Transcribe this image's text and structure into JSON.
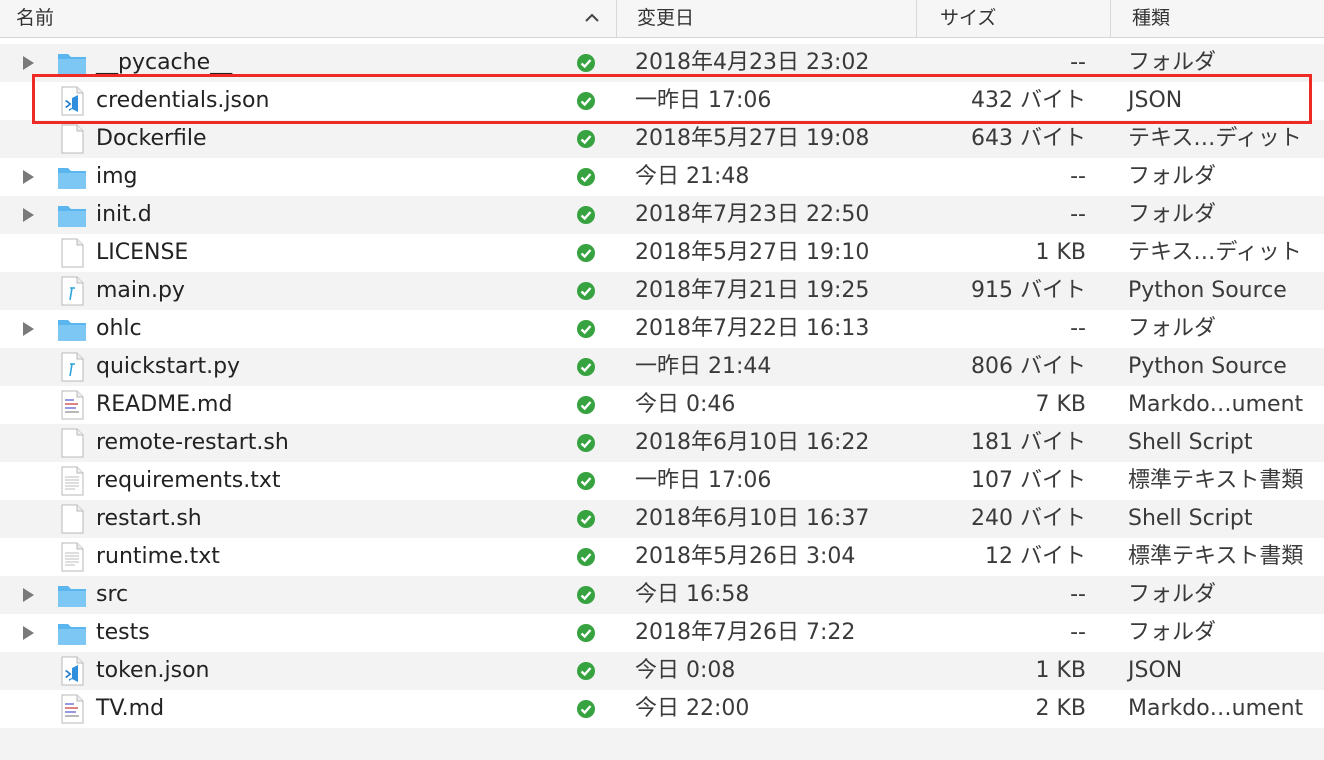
{
  "header": {
    "name": "名前",
    "date": "変更日",
    "size": "サイズ",
    "kind": "種類"
  },
  "colors": {
    "folder": "#5bb5ef",
    "status_green": "#37a340",
    "highlight": "#ee2a24",
    "vscode_blue": "#1f7bc8"
  },
  "rows": [
    {
      "name": "__pycache__",
      "date": "2018年4月23日 23:02",
      "size": "--",
      "kind": "フォルダ",
      "icon": "folder-icon",
      "expandable": true
    },
    {
      "name": "credentials.json",
      "date": "一昨日 17:06",
      "size": "432 バイト",
      "kind": "JSON",
      "icon": "json-file-icon",
      "expandable": false,
      "highlighted": true
    },
    {
      "name": "Dockerfile",
      "date": "2018年5月27日 19:08",
      "size": "643 バイト",
      "kind": "テキス…ディット",
      "icon": "blank-file-icon",
      "expandable": false
    },
    {
      "name": "img",
      "date": "今日 21:48",
      "size": "--",
      "kind": "フォルダ",
      "icon": "folder-icon",
      "expandable": true
    },
    {
      "name": "init.d",
      "date": "2018年7月23日 22:50",
      "size": "--",
      "kind": "フォルダ",
      "icon": "folder-icon",
      "expandable": true
    },
    {
      "name": "LICENSE",
      "date": "2018年5月27日 19:10",
      "size": "1 KB",
      "kind": "テキス…ディット",
      "icon": "blank-file-icon",
      "expandable": false
    },
    {
      "name": "main.py",
      "date": "2018年7月21日 19:25",
      "size": "915 バイト",
      "kind": "Python Source",
      "icon": "python-file-icon",
      "expandable": false
    },
    {
      "name": "ohlc",
      "date": "2018年7月22日 16:13",
      "size": "--",
      "kind": "フォルダ",
      "icon": "folder-icon",
      "expandable": true
    },
    {
      "name": "quickstart.py",
      "date": "一昨日 21:44",
      "size": "806 バイト",
      "kind": "Python Source",
      "icon": "python-file-icon",
      "expandable": false
    },
    {
      "name": "README.md",
      "date": "今日 0:46",
      "size": "7 KB",
      "kind": "Markdo…ument",
      "icon": "markdown-file-icon",
      "expandable": false
    },
    {
      "name": "remote-restart.sh",
      "date": "2018年6月10日 16:22",
      "size": "181 バイト",
      "kind": "Shell Script",
      "icon": "blank-file-icon",
      "expandable": false
    },
    {
      "name": "requirements.txt",
      "date": "一昨日 17:06",
      "size": "107 バイト",
      "kind": "標準テキスト書類",
      "icon": "text-file-icon",
      "expandable": false
    },
    {
      "name": "restart.sh",
      "date": "2018年6月10日 16:37",
      "size": "240 バイト",
      "kind": "Shell Script",
      "icon": "blank-file-icon",
      "expandable": false
    },
    {
      "name": "runtime.txt",
      "date": "2018年5月26日 3:04",
      "size": "12 バイト",
      "kind": "標準テキスト書類",
      "icon": "text-file-icon",
      "expandable": false
    },
    {
      "name": "src",
      "date": "今日 16:58",
      "size": "--",
      "kind": "フォルダ",
      "icon": "folder-icon",
      "expandable": true
    },
    {
      "name": "tests",
      "date": "2018年7月26日 7:22",
      "size": "--",
      "kind": "フォルダ",
      "icon": "folder-icon",
      "expandable": true
    },
    {
      "name": "token.json",
      "date": "今日 0:08",
      "size": "1 KB",
      "kind": "JSON",
      "icon": "json-file-icon",
      "expandable": false
    },
    {
      "name": "TV.md",
      "date": "今日 22:00",
      "size": "2 KB",
      "kind": "Markdo…ument",
      "icon": "markdown-file-icon",
      "expandable": false
    }
  ]
}
